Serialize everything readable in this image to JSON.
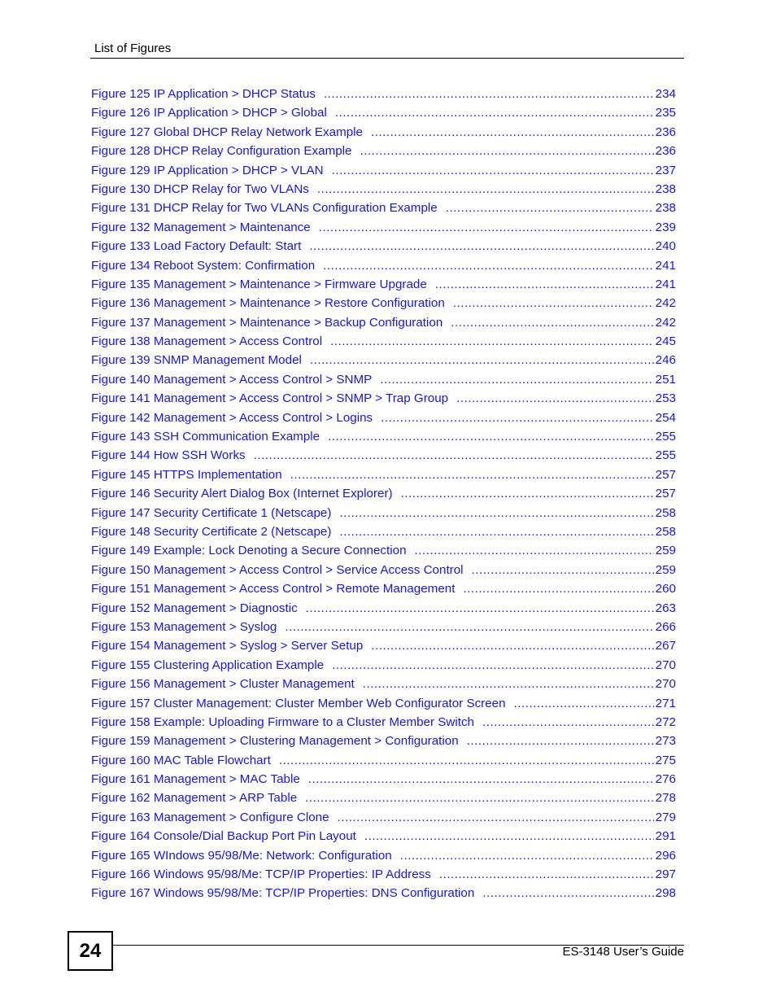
{
  "header": {
    "section_title": "List of Figures"
  },
  "toc": {
    "entries": [
      {
        "title": "Figure 125 IP Application > DHCP Status",
        "page": "234"
      },
      {
        "title": "Figure 126 IP Application > DHCP > Global",
        "page": "235"
      },
      {
        "title": "Figure 127 Global DHCP Relay Network Example",
        "page": "236"
      },
      {
        "title": "Figure 128 DHCP Relay Configuration Example",
        "page": "236"
      },
      {
        "title": "Figure 129 IP Application > DHCP > VLAN",
        "page": "237"
      },
      {
        "title": "Figure 130 DHCP Relay for Two VLANs",
        "page": "238"
      },
      {
        "title": "Figure 131 DHCP Relay for Two VLANs Configuration Example",
        "page": "238"
      },
      {
        "title": "Figure 132 Management > Maintenance",
        "page": "239"
      },
      {
        "title": "Figure 133 Load Factory Default: Start",
        "page": "240"
      },
      {
        "title": "Figure 134 Reboot System: Confirmation",
        "page": "241"
      },
      {
        "title": "Figure 135 Management > Maintenance > Firmware Upgrade",
        "page": "241"
      },
      {
        "title": "Figure 136 Management > Maintenance > Restore Configuration",
        "page": "242"
      },
      {
        "title": "Figure 137 Management > Maintenance > Backup Configuration",
        "page": "242"
      },
      {
        "title": "Figure 138 Management > Access Control",
        "page": "245"
      },
      {
        "title": "Figure 139 SNMP Management Model",
        "page": "246"
      },
      {
        "title": "Figure 140 Management > Access Control > SNMP",
        "page": "251"
      },
      {
        "title": "Figure 141 Management > Access Control > SNMP > Trap Group",
        "page": "253"
      },
      {
        "title": "Figure 142 Management > Access Control > Logins",
        "page": "254"
      },
      {
        "title": "Figure 143 SSH Communication Example",
        "page": "255"
      },
      {
        "title": "Figure 144 How SSH Works",
        "page": "255"
      },
      {
        "title": "Figure 145 HTTPS Implementation",
        "page": "257"
      },
      {
        "title": "Figure 146 Security Alert Dialog Box (Internet Explorer)",
        "page": "257"
      },
      {
        "title": "Figure 147 Security Certificate 1 (Netscape)",
        "page": "258"
      },
      {
        "title": "Figure 148 Security Certificate 2 (Netscape)",
        "page": "258"
      },
      {
        "title": "Figure 149 Example: Lock Denoting a Secure Connection",
        "page": "259"
      },
      {
        "title": "Figure 150 Management > Access Control > Service Access Control",
        "page": "259"
      },
      {
        "title": "Figure 151 Management > Access Control > Remote Management",
        "page": "260"
      },
      {
        "title": "Figure 152 Management > Diagnostic",
        "page": "263"
      },
      {
        "title": "Figure 153 Management > Syslog",
        "page": "266"
      },
      {
        "title": "Figure 154 Management > Syslog > Server Setup",
        "page": "267"
      },
      {
        "title": "Figure 155 Clustering Application Example",
        "page": "270"
      },
      {
        "title": "Figure 156 Management > Cluster Management",
        "page": "270"
      },
      {
        "title": "Figure 157 Cluster Management: Cluster Member Web Configurator Screen",
        "page": "271"
      },
      {
        "title": "Figure 158 Example: Uploading Firmware to a Cluster Member Switch",
        "page": "272"
      },
      {
        "title": "Figure 159 Management > Clustering Management > Configuration",
        "page": "273"
      },
      {
        "title": "Figure 160 MAC Table Flowchart",
        "page": "275"
      },
      {
        "title": "Figure 161 Management > MAC Table",
        "page": "276"
      },
      {
        "title": "Figure 162 Management > ARP Table",
        "page": "278"
      },
      {
        "title": "Figure 163 Management > Configure Clone",
        "page": "279"
      },
      {
        "title": "Figure 164 Console/Dial Backup Port Pin Layout",
        "page": "291"
      },
      {
        "title": "Figure 165 WIndows 95/98/Me: Network: Configuration",
        "page": "296"
      },
      {
        "title": "Figure 166 Windows 95/98/Me: TCP/IP Properties: IP Address",
        "page": "297"
      },
      {
        "title": "Figure 167 Windows 95/98/Me: TCP/IP Properties: DNS Configuration",
        "page": "298"
      }
    ]
  },
  "footer": {
    "page_number": "24",
    "guide_title": "ES-3148 User’s Guide"
  },
  "colors": {
    "link": "#1414ff",
    "text": "#000000"
  }
}
